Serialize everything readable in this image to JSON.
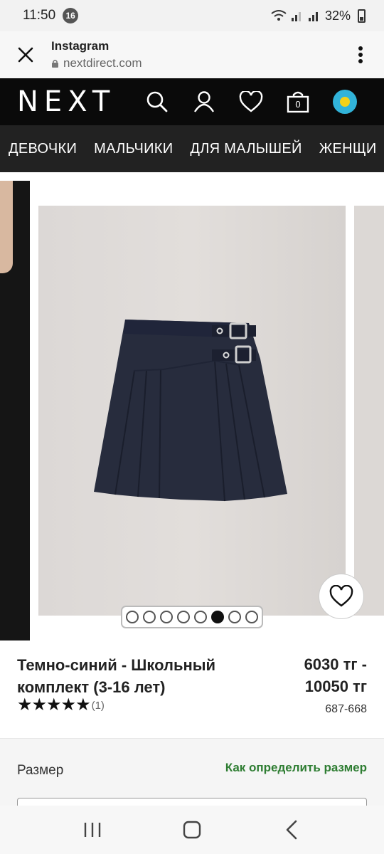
{
  "status": {
    "time": "11:50",
    "notifications": "16",
    "battery": "32%"
  },
  "tab": {
    "title": "Instagram",
    "url": "nextdirect.com",
    "close_icon": "close-icon",
    "menu_icon": "more-vert-icon"
  },
  "header": {
    "logo": "NEXT",
    "bag_count": "0",
    "icons": [
      "search-icon",
      "account-icon",
      "heart-icon",
      "bag-icon",
      "country-flag-icon"
    ]
  },
  "categories": [
    "ДЕВОЧКИ",
    "МАЛЬЧИКИ",
    "ДЛЯ МАЛЫШЕЙ",
    "ЖЕНЩИ"
  ],
  "gallery": {
    "total_images": 8,
    "active_index": 5
  },
  "product": {
    "title": "Темно-синий - Школьный комплект (3-16 лет)",
    "price": "6030 тг - 10050 тг",
    "rating_stars": 5,
    "rating_count": "(1)",
    "sku": "687-668"
  },
  "size": {
    "label": "Размер",
    "guide_link": "Как определить размер"
  },
  "colors": {
    "header_bg": "#0a0a0a",
    "nav_bg": "#222222",
    "link_green": "#2e7d32",
    "skirt_navy": "#252a3a"
  }
}
